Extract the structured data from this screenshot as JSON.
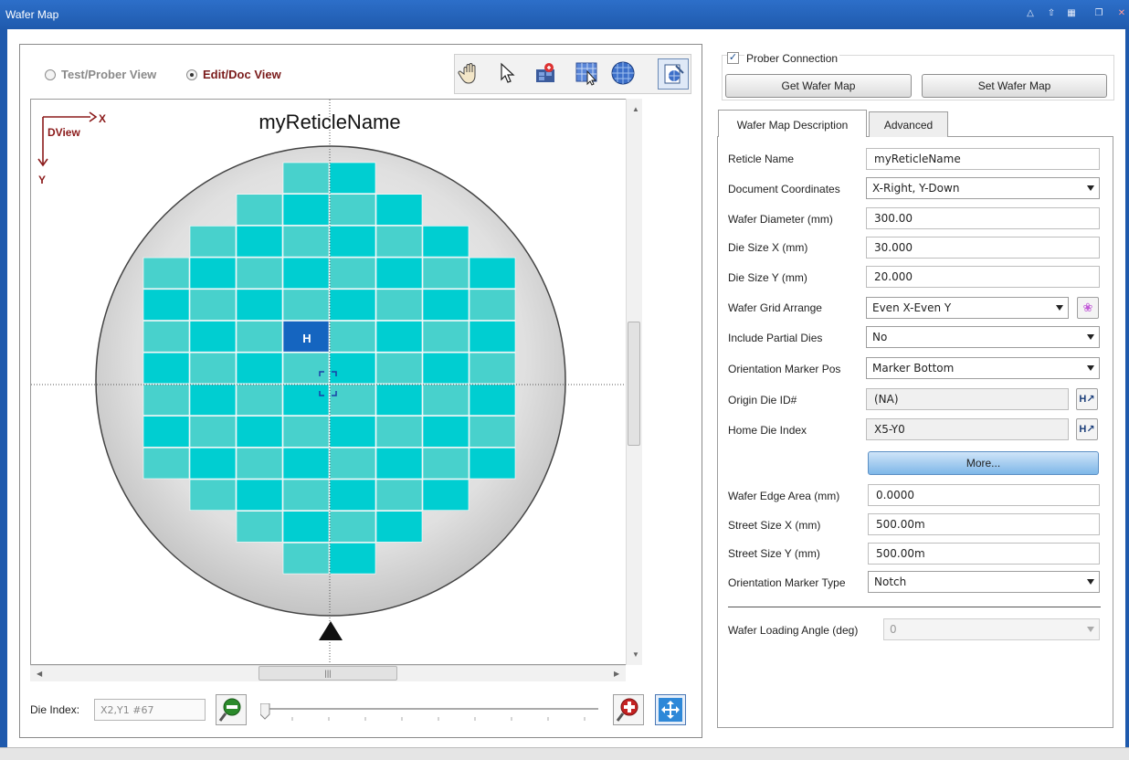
{
  "window": {
    "title": "Wafer Map",
    "title_icons": [
      "pin-icon",
      "upload-icon",
      "grid-icon",
      "restore-icon",
      "close-icon"
    ]
  },
  "view_options": {
    "test_prober": "Test/Prober View",
    "edit_doc": "Edit/Doc View",
    "selected": "Edit/Doc View"
  },
  "toolbar": {
    "tools": [
      "hand-icon",
      "pointer-icon",
      "color-die-icon",
      "select-region-icon",
      "globe-wafer-icon",
      "export-doc-icon"
    ]
  },
  "map": {
    "reticle_name": "myReticleName",
    "axis_x": "X",
    "axis_y": "Y",
    "view_label": "DView",
    "home_die_label": "H",
    "die_color_a": "#00CED1",
    "die_color_b": "#48D1CC",
    "home_die_color": "#1565C0",
    "wafer_color": "#D8D8D8"
  },
  "bottom": {
    "die_index_label": "Die Index:",
    "die_index_value": "X2,Y1 #67"
  },
  "prober": {
    "connection_label": "Prober Connection",
    "connection_checked": true,
    "get_button": "Get Wafer Map",
    "set_button": "Set Wafer Map"
  },
  "tabs": {
    "active": "Wafer Map Description",
    "other": "Advanced"
  },
  "form": {
    "reticle_name_label": "Reticle Name",
    "reticle_name_value": "myReticleName",
    "doc_coords_label": "Document Coordinates",
    "doc_coords_value": "X-Right, Y-Down",
    "wafer_diameter_label": "Wafer Diameter (mm)",
    "wafer_diameter_value": "300.00",
    "die_size_x_label": "Die Size X (mm)",
    "die_size_x_value": "30.000",
    "die_size_y_label": "Die Size Y (mm)",
    "die_size_y_value": "20.000",
    "grid_arrange_label": "Wafer Grid Arrange",
    "grid_arrange_value": "Even X-Even Y",
    "partial_dies_label": "Include Partial Dies",
    "partial_dies_value": "No",
    "marker_pos_label": "Orientation Marker Pos",
    "marker_pos_value": "Marker Bottom",
    "origin_die_label": "Origin Die ID#",
    "origin_die_value": "(NA)",
    "home_die_label": "Home Die Index",
    "home_die_value": "X5-Y0",
    "more_button": "More...",
    "edge_area_label": "Wafer Edge Area (mm)",
    "edge_area_value": "0.0000",
    "street_x_label": "Street Size X (mm)",
    "street_x_value": "500.00m",
    "street_y_label": "Street Size Y (mm)",
    "street_y_value": "500.00m",
    "marker_type_label": "Orientation Marker Type",
    "marker_type_value": "Notch",
    "loading_angle_label": "Wafer Loading Angle (deg)",
    "loading_angle_value": "0"
  }
}
